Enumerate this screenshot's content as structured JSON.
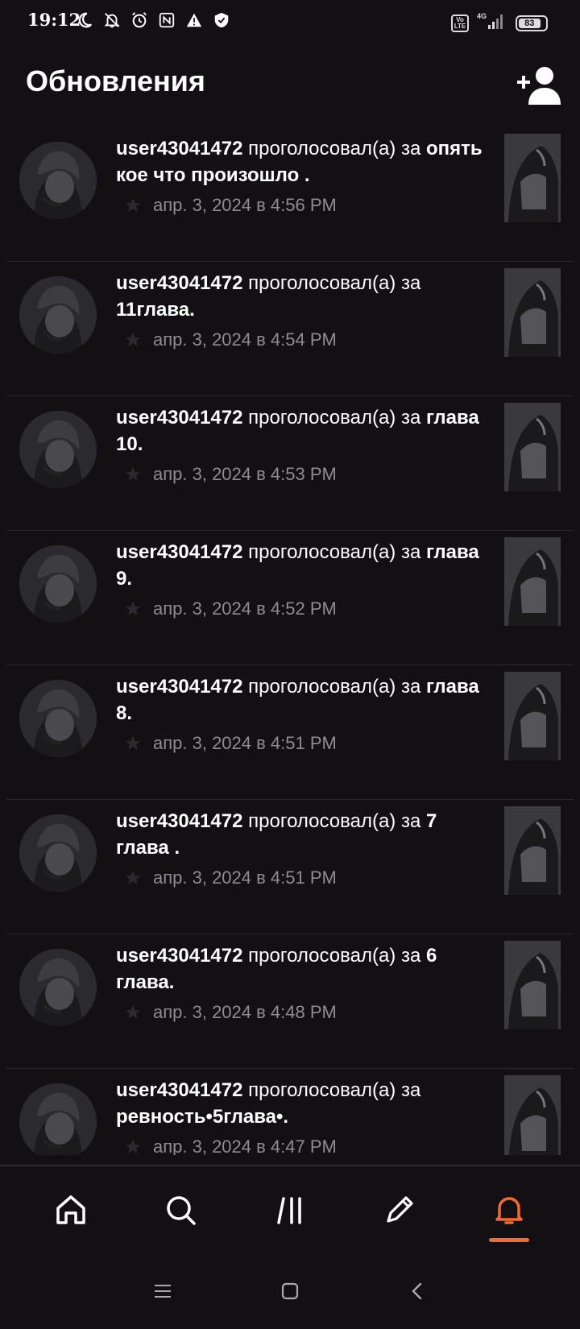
{
  "status_bar": {
    "time": "19:12",
    "battery": "83",
    "network": "4G",
    "left_icons": [
      "moon-icon",
      "bell-off-icon",
      "alarm-icon",
      "nfc-icon",
      "warning-icon",
      "shield-icon"
    ]
  },
  "header": {
    "title": "Обновления",
    "action_icon": "add-user-icon"
  },
  "feed": {
    "items": [
      {
        "user": "user43041472",
        "action": " проголосовал(а) за ",
        "target": "опять кое что произошло .",
        "time": "апр. 3, 2024 в 4:56 PM"
      },
      {
        "user": "user43041472",
        "action": " проголосовал(а) за ",
        "target": "11глава.",
        "time": "апр. 3, 2024 в 4:54 PM"
      },
      {
        "user": "user43041472",
        "action": " проголосовал(а) за ",
        "target": "глава 10.",
        "time": "апр. 3, 2024 в 4:53 PM"
      },
      {
        "user": "user43041472",
        "action": " проголосовал(а) за ",
        "target": "глава 9.",
        "time": "апр. 3, 2024 в 4:52 PM"
      },
      {
        "user": "user43041472",
        "action": " проголосовал(а) за ",
        "target": "глава 8.",
        "time": "апр. 3, 2024 в 4:51 PM"
      },
      {
        "user": "user43041472",
        "action": " проголосовал(а) за ",
        "target": "7 глава .",
        "time": "апр. 3, 2024 в 4:51 PM"
      },
      {
        "user": "user43041472",
        "action": " проголосовал(а) за ",
        "target": "6 глава.",
        "time": "апр. 3, 2024 в 4:48 PM"
      },
      {
        "user": "user43041472",
        "action": " проголосовал(а) за ",
        "target": "ревность•5глава•.",
        "time": "апр. 3, 2024 в 4:47 PM"
      }
    ]
  },
  "bottom_nav": {
    "items": [
      "home-icon",
      "search-icon",
      "library-icon",
      "write-icon",
      "notifications-icon"
    ],
    "active": "notifications-icon",
    "accent_color": "#f26a2e"
  },
  "system_nav": [
    "menu-icon",
    "home-square-icon",
    "back-icon"
  ],
  "colors": {
    "background": "#121013",
    "text": "#ffffff",
    "muted": "#8d8c90",
    "accent": "#f26a2e"
  }
}
